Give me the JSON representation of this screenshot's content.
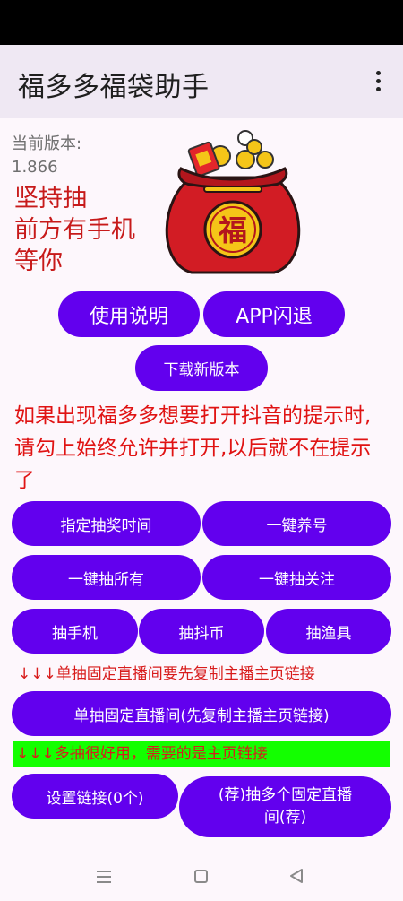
{
  "app_bar": {
    "title": "福多多福袋助手",
    "menu_icon": "more-vert-icon"
  },
  "version": {
    "label": "当前版本:",
    "number": "1.866"
  },
  "slogan": {
    "line1": "坚持抽",
    "line2": "前方有手机",
    "line3": "等你"
  },
  "bag_image": {
    "icon": "lucky-bag-icon",
    "character": "福"
  },
  "buttons": {
    "instructions": "使用说明",
    "app_crash": "APP闪退",
    "download": "下载新版本",
    "draw_time": "指定抽奖时间",
    "one_key_raise": "一键养号",
    "draw_all": "一键抽所有",
    "draw_follow": "一键抽关注",
    "draw_phone": "抽手机",
    "draw_coin": "抽抖币",
    "draw_fishing": "抽渔具",
    "single_live": "单抽固定直播间(先复制主播主页链接)",
    "set_links": "设置链接(0个)",
    "multi_live_line1": "(荐)抽多个固定直播",
    "multi_live_line2": "间(荐)"
  },
  "notice": "如果出现福多多想要打开抖音的提示时,请勾上始终允许并打开,以后就不在提示了",
  "hints": {
    "single": "↓↓↓单抽固定直播间要先复制主播主页链接",
    "multi": "↓↓↓多抽很好用，需要的是主页链接"
  },
  "colors": {
    "accent": "#6200ee",
    "notice_red": "#e01313",
    "highlight_green": "#13ff00",
    "app_bar": "#efe8f3"
  },
  "nav_bar": {
    "menu_icon": "nav-menu-icon",
    "home_icon": "nav-home-icon",
    "back_icon": "nav-back-icon"
  }
}
